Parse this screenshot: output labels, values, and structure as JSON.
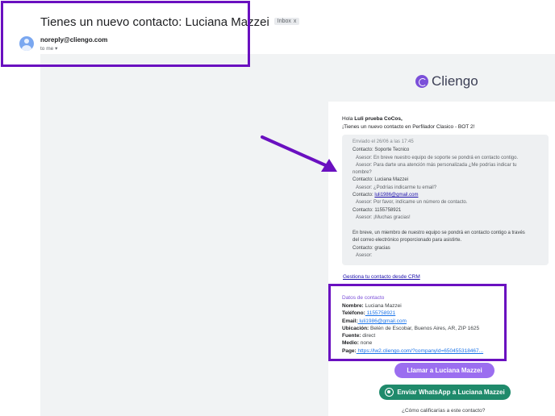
{
  "email": {
    "subject": "Tienes un nuevo contacto: Luciana Mazzei",
    "label_chip": "Inbox",
    "label_chip_close": "x",
    "sender": "noreply@cliengo.com",
    "recipient": "to me",
    "recipient_caret": "▾"
  },
  "brand": {
    "name": "Cliengo",
    "accent": "#7b4fd9"
  },
  "greeting": {
    "prefix": "Hola ",
    "name": "Luli prueba CoCos,",
    "line2": "¡Tienes un nuevo contacto en Perfilador Clasico - BOT 2!"
  },
  "conversation": {
    "date": "Enviado el 26/06 a las 17:45",
    "lines": [
      {
        "type": "contacto",
        "text": "Contacto: Soporte Tecnico"
      },
      {
        "type": "asesor",
        "text": "Asesor: En breve nuestro equipo de soporte se pondrá en contacto contigo."
      },
      {
        "type": "asesor",
        "text": "Asesor: Para darte una atención más personalizada ¿Me podrías indicar tu"
      },
      {
        "type": "asesor",
        "text": "nombre?"
      },
      {
        "type": "contacto",
        "text": "Contacto: Luciana Mazzei"
      },
      {
        "type": "asesor",
        "text": "Asesor: ¿Podrías indicarme tu email?"
      },
      {
        "type": "contacto",
        "text": "Contacto: "
      },
      {
        "type": "asesor",
        "text": "Asesor: Por favor, indícame un número de contacto."
      },
      {
        "type": "contacto",
        "text": "Contacto: 1155758921"
      },
      {
        "type": "asesor",
        "text": "Asesor: ¡Muchas gracias!"
      },
      {
        "type": "contacto",
        "text": "En breve, un miembro de nuestro equipo se pondrá en contacto contigo a través"
      },
      {
        "type": "contacto",
        "text": "del correo electrónico proporcionado para asistirte."
      },
      {
        "type": "contacto",
        "text": "Contacto: gracias"
      },
      {
        "type": "asesor",
        "text": "Asesor:"
      }
    ],
    "email_link": "luli1986@gmail.com"
  },
  "crm_link": "Gestiona tu contacto desde CRM",
  "contact": {
    "title": "Datos de contacto",
    "rows": [
      {
        "label": "Nombre:",
        "value": " Luciana Mazzei"
      },
      {
        "label": "Teléfono:",
        "value": " 1155758921"
      },
      {
        "label": "Email:",
        "value": " luli1986@gmail.com"
      },
      {
        "label": "Ubicación:",
        "value": " Belén de Escobar, Buenos Aires, AR, ZIP 1625"
      },
      {
        "label": "Fuente:",
        "value": " direct"
      },
      {
        "label": "Medio:",
        "value": " none"
      },
      {
        "label": "Page:",
        "value": " https://lw2.cliengo.com/?companyId=650455318467..."
      }
    ]
  },
  "buttons": {
    "call": "Llamar a Luciana Mazzei",
    "whatsapp": "Enviar WhatsApp a Luciana Mazzei"
  },
  "rating_question": "¿Cómo calificarías a este contacto?",
  "annotation_color": "#6a10c0"
}
